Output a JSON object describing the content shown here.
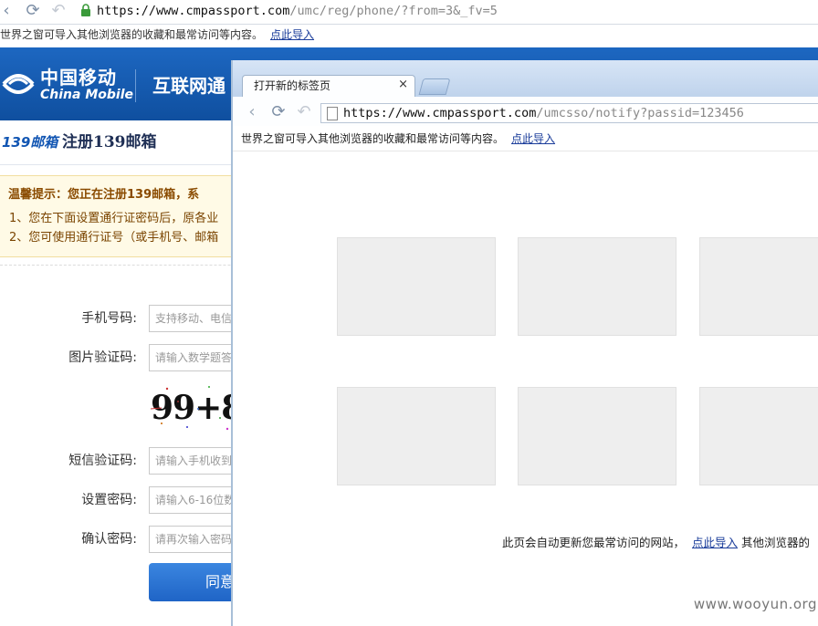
{
  "background_browser": {
    "url_scheme_host": "https://www.cmpassport.com",
    "url_path": "/umc/reg/phone/?from=3&_fv=5",
    "bookmark_message": "世界之窗可导入其他浏览器的收藏和最常访问等内容。",
    "bookmark_link": "点此导入"
  },
  "page": {
    "logo_cn": "中国移动",
    "logo_en": "China Mobile",
    "header_title": "互联网通",
    "reg_logo": "139邮箱",
    "reg_title": "注册139邮箱",
    "notice_head": "温馨提示：您正在注册139邮箱，系",
    "notice_line1": "1、您在下面设置通行证密码后，原各业",
    "notice_line2": "2、您可使用通行证号（或手机号、邮箱",
    "fields": {
      "phone_label": "手机号码:",
      "phone_placeholder": "支持移动、电信",
      "captcha_label": "图片验证码:",
      "captcha_placeholder": "请输入数学题答",
      "captcha_text": "99+8",
      "sms_label": "短信验证码:",
      "sms_placeholder": "请输入手机收到",
      "password_label": "设置密码:",
      "password_placeholder": "请输入6-16位数",
      "confirm_label": "确认密码:",
      "confirm_placeholder": "请再次输入密码"
    },
    "agree_button": "同意"
  },
  "popup": {
    "tab_title": "打开新的标签页",
    "tab_close": "×",
    "url_scheme_host": "https://www.cmpassport.com",
    "url_path": "/umcsso/notify?passid=123456",
    "bookmark_message": "世界之窗可导入其他浏览器的收藏和最常访问等内容。",
    "bookmark_link": "点此导入",
    "footer_message": "此页会自动更新您最常访问的网站，",
    "footer_link": "点此导入",
    "footer_tail": "其他浏览器的"
  },
  "watermark": "www.wooyun.org",
  "colors": {
    "brand_blue": "#1d67c1",
    "link_blue": "#1a3c9a",
    "notice_bg": "#fffae6"
  }
}
